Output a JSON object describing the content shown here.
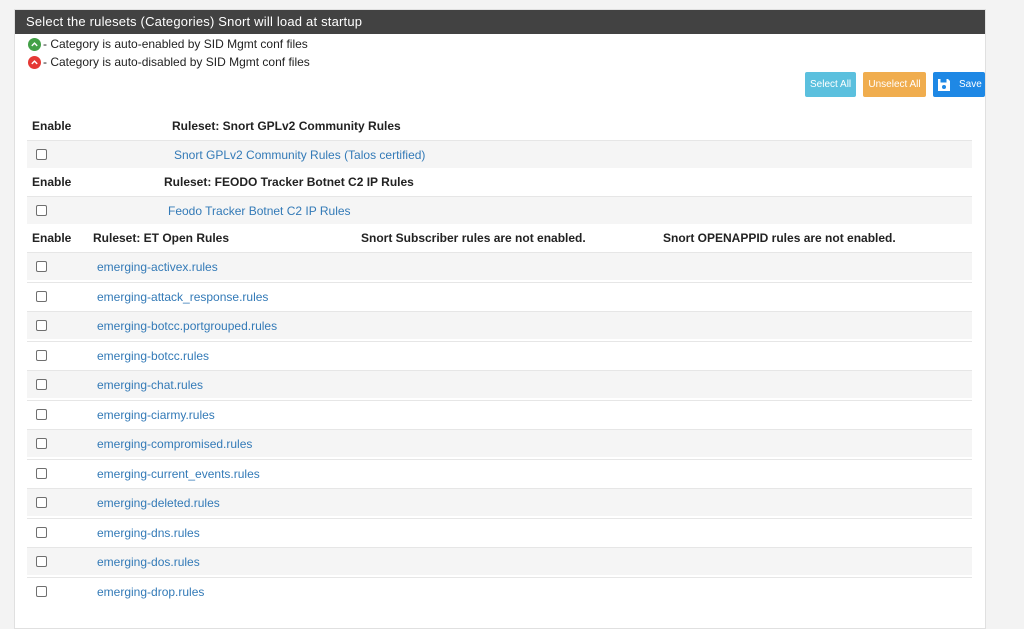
{
  "panel": {
    "title": "Select the rulesets (Categories) Snort will load at startup"
  },
  "legend": {
    "enabled_text": "- Category is auto-enabled by SID Mgmt conf files",
    "disabled_text": "- Category is auto-disabled by SID Mgmt conf files",
    "enabled_color": "#43a047",
    "disabled_color": "#e53935",
    "enabled_icon": "chevron-up-circle-icon",
    "disabled_icon": "chevron-up-circle-icon"
  },
  "buttons": {
    "select_all": "Select All",
    "unselect_all": "Unselect All",
    "save": "Save",
    "save_icon": "floppy-disk-icon"
  },
  "sections": {
    "gplv2": {
      "enable_header": "Enable",
      "ruleset_header": "Ruleset: Snort GPLv2 Community Rules",
      "rule": "Snort GPLv2 Community Rules (Talos certified)"
    },
    "feodo": {
      "enable_header": "Enable",
      "ruleset_header": "Ruleset: FEODO Tracker Botnet C2 IP Rules",
      "rule": "Feodo Tracker Botnet C2 IP Rules"
    },
    "et_open": {
      "enable_header": "Enable",
      "ruleset_header": "Ruleset: ET Open Rules",
      "subscriber_note": "Snort Subscriber rules are not enabled.",
      "openappid_note": "Snort OPENAPPID rules are not enabled.",
      "rules": [
        "emerging-activex.rules",
        "emerging-attack_response.rules",
        "emerging-botcc.portgrouped.rules",
        "emerging-botcc.rules",
        "emerging-chat.rules",
        "emerging-ciarmy.rules",
        "emerging-compromised.rules",
        "emerging-current_events.rules",
        "emerging-deleted.rules",
        "emerging-dns.rules",
        "emerging-dos.rules",
        "emerging-drop.rules"
      ]
    }
  },
  "colors": {
    "heading_bg": "#424242",
    "link": "#337ab7",
    "select_all": "#5bc0de",
    "unselect_all": "#f0ad4e",
    "save": "#1e88e5"
  }
}
